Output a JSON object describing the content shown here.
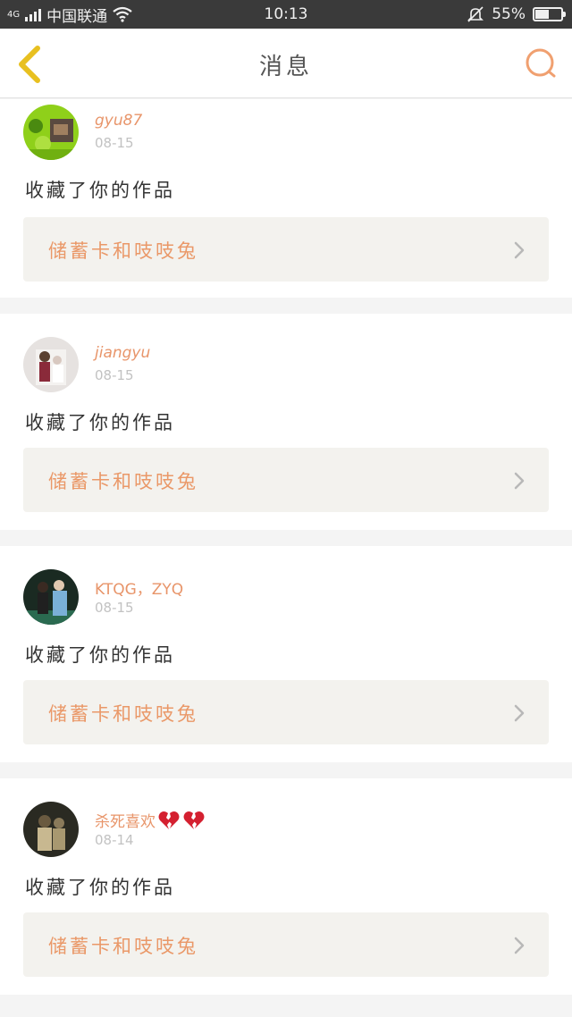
{
  "status_bar": {
    "network": "4G",
    "carrier": "中国联通",
    "time": "10:13",
    "battery": "55%",
    "battery_level": 0.55
  },
  "nav": {
    "title": "消息"
  },
  "messages": [
    {
      "username": "gyu87",
      "date": "08-15",
      "action": "收藏了你的作品",
      "work_title": "储蓄卡和吱吱兔"
    },
    {
      "username": "jiangyu",
      "date": "08-15",
      "action": "收藏了你的作品",
      "work_title": "储蓄卡和吱吱兔"
    },
    {
      "username": "KTQG，ZYQ",
      "date": "08-15",
      "action": "收藏了你的作品",
      "work_title": "储蓄卡和吱吱兔"
    },
    {
      "username": "杀死喜欢",
      "date": "08-14",
      "action": "收藏了你的作品",
      "work_title": "储蓄卡和吱吱兔"
    }
  ],
  "colors": {
    "accent": "#e8956a",
    "back_arrow": "#e8c020",
    "heart": "#d42030"
  },
  "icons": [
    "back-chevron-icon",
    "search-icon",
    "wifi-icon",
    "mute-bell-icon",
    "chevron-right-icon",
    "broken-heart-icon"
  ]
}
